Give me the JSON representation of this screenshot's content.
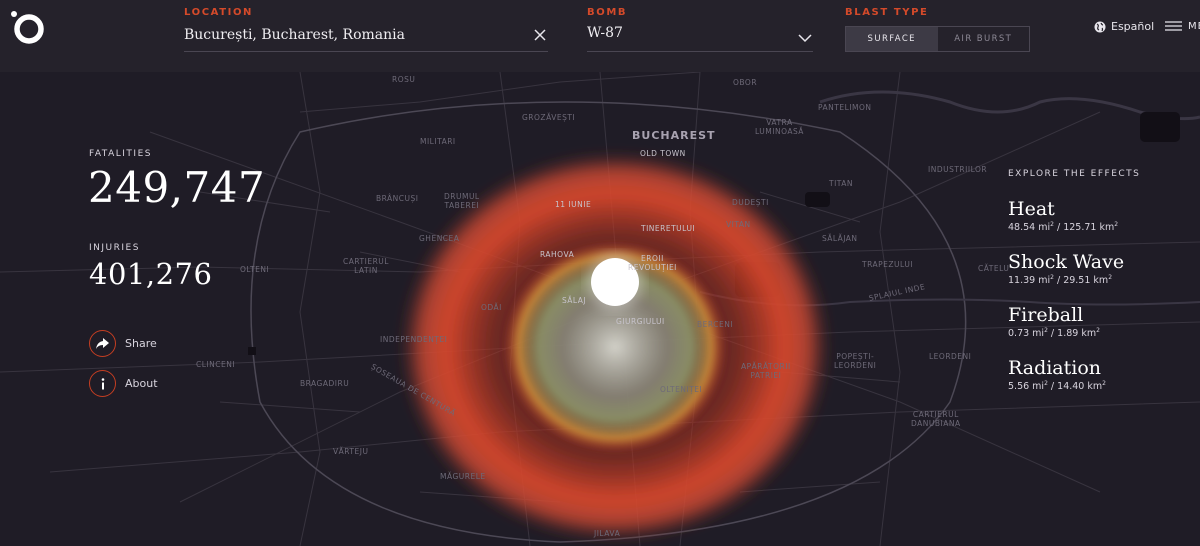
{
  "header": {
    "location_label": "LOCATION",
    "location_value": "București, Bucharest, Romania",
    "bomb_label": "BOMB",
    "bomb_value": "W-87",
    "blast_label": "BLAST TYPE",
    "blast_options": [
      "SURFACE",
      "AIR BURST"
    ],
    "blast_selected": "SURFACE",
    "language": "Español",
    "menu": "ME"
  },
  "stats": {
    "fatalities_label": "FATALITIES",
    "fatalities": "249,747",
    "injuries_label": "INJURIES",
    "injuries": "401,276"
  },
  "actions": {
    "share": "Share",
    "about": "About"
  },
  "effects": {
    "title": "EXPLORE THE EFFECTS",
    "items": [
      {
        "name": "Heat",
        "mi": "48.54 mi",
        "km": "125.71 km"
      },
      {
        "name": "Shock Wave",
        "mi": "11.39 mi",
        "km": "29.51 km"
      },
      {
        "name": "Fireball",
        "mi": "0.73 mi",
        "km": "1.89 km"
      },
      {
        "name": "Radiation",
        "mi": "5.56 mi",
        "km": "14.40 km"
      }
    ]
  },
  "map": {
    "city": "BUCHAREST",
    "labels": {
      "old_town": "OLD TOWN",
      "rosu": "ROSU",
      "obor": "OBOR",
      "militari": "MILITARI",
      "grozavesti": "GROZĂVEȘTI",
      "vatra_luminoasa": "VATRA\nLUMINOASĂ",
      "pantelimon": "PANTELIMON",
      "brancusi": "BRÂNCUȘI",
      "drumul_taberei": "DRUMUL\nTABEREI",
      "unsprezece_iunie": "11 IUNIE",
      "dudesti": "DUDEȘTI",
      "titan": "TITAN",
      "industriilor": "INDUSTRIILOR",
      "ghencea": "GHENCEA",
      "tineretului": "TINERETULUI",
      "vitan": "VITAN",
      "salajan": "SĂLĂJAN",
      "cartierul_latin": "CARTIERUL\nLATIN",
      "olteni": "OLTENI",
      "rahova": "RAHOVA",
      "eroii_revolutiei": "EROII\nREVOLUȚIEI",
      "trapezului": "TRAPEZULUI",
      "odai": "ODĂI",
      "salaj": "SĂLAJ",
      "giurgiului": "GIURGIULUI",
      "berceni": "BERCENI",
      "independentei": "INDEPENDENȚEI",
      "clinceni": "CLINCENI",
      "bragadiru": "BRAGADIRU",
      "soseaua_de_centura": "ȘOSEAUA DE CENTURĂ",
      "aparatorii_patriei": "APĂRĂTORII\nPATRIEI",
      "popesti_leordeni": "POPEȘTI-\nLEORDENI",
      "leordeni": "LEORDENI",
      "oltenitei": "OLTENIȚEI",
      "cartierul_danubiana": "CARTIERUL\nDANUBIANA",
      "varteju": "VĂRTEJU",
      "magurele": "MĂGURELE",
      "jilava": "JILAVA",
      "catelu": "CĂTELU",
      "splaiul": "SPLAIUL INDE"
    }
  }
}
